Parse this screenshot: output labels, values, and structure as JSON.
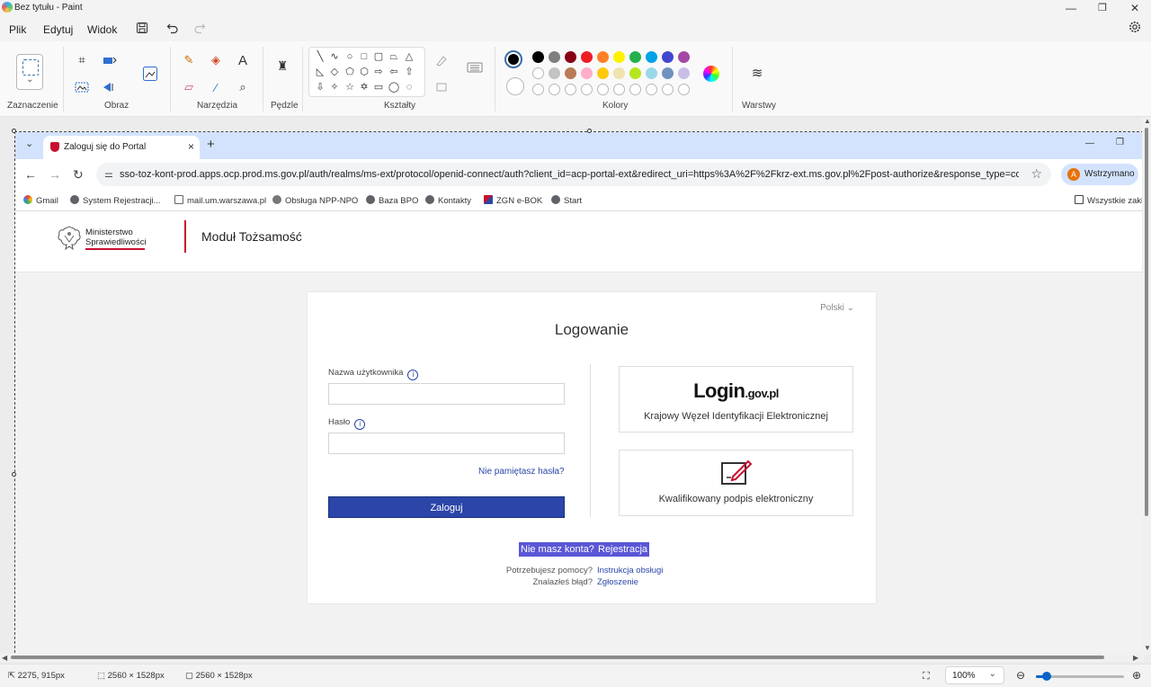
{
  "window": {
    "title": "Bez tytułu - Paint",
    "minimize": "—",
    "maximize": "❐",
    "close": "✕"
  },
  "menu": {
    "items": [
      "Plik",
      "Edytuj",
      "Widok"
    ]
  },
  "ribbon": {
    "groups": {
      "selection": "Zaznaczenie",
      "image": "Obraz",
      "tools": "Narzędzia",
      "brushes": "Pędzle",
      "shapes": "Kształty",
      "colors": "Kolory",
      "layers": "Warstwy"
    },
    "tool_icons": {
      "crop": "⌗",
      "rotate": "⟳",
      "pencil": "✎",
      "fill": "◈",
      "text": "A",
      "eraser": "▱",
      "picker": "⁄",
      "zoom": "⌕",
      "brush": "♜",
      "layers": "≋"
    },
    "shapes": [
      "╲",
      "∿",
      "○",
      "□",
      "▢",
      "⏢",
      "△",
      "◺",
      "◇",
      "⬠",
      "⬡",
      "⇨",
      "⇦",
      "⇧",
      "⇩",
      "✧",
      "☆",
      "✡",
      "▭",
      "◯",
      "◌"
    ],
    "palette_row1": [
      "#000000",
      "#7f7f7f",
      "#880015",
      "#ed1c24",
      "#ff7f27",
      "#fff200",
      "#22b14c",
      "#00a2e8",
      "#3f48cc",
      "#a349a4"
    ],
    "palette_row2": [
      "#ffffff",
      "#c3c3c3",
      "#b97a57",
      "#ffaec9",
      "#ffc90e",
      "#efe4b0",
      "#b5e61d",
      "#99d9ea",
      "#7092be",
      "#c8bfe7"
    ],
    "primary_color": "#000000",
    "secondary_color": "#ffffff"
  },
  "browser": {
    "tab_title": "Zaloguj się do Portal",
    "new_tab": "+",
    "minimize": "—",
    "maximize": "❐",
    "url": "sso-toz-kont-prod.apps.ocp.prod.ms.gov.pl/auth/realms/ms-ext/protocol/openid-connect/auth?client_id=acp-portal-ext&redirect_uri=https%3A%2F%2Fkrz-ext.ms.gov.pl%2Fpost-authorize&response_type=code&s...",
    "profile_initial": "A",
    "profile_label": "Wstrzymano",
    "bookmarks": [
      "Gmail",
      "System Rejestracji...",
      "mail.um.warszawa.pl",
      "Obsługa NPP-NPO",
      "Baza BPO",
      "Kontakty",
      "ZGN e-BOK",
      "Start"
    ],
    "all_bookmarks": "Wszystkie zakł"
  },
  "site": {
    "org_name_line1": "Ministerstwo",
    "org_name_line2": "Sprawiedliwości",
    "header_title": "Moduł Tożsamość",
    "language": "Polski",
    "login_title": "Logowanie",
    "username_label": "Nazwa użytkownika",
    "username_value": "",
    "password_label": "Hasło",
    "password_value": "",
    "info_glyph": "i",
    "forgot_password": "Nie pamiętasz hasła?",
    "login_button": "Zaloguj",
    "login_gov_main": "Login",
    "login_gov_suffix": ".gov.pl",
    "login_gov_caption": "Krajowy Węzeł Identyfikacji Elektronicznej",
    "qes_caption": "Kwalifikowany podpis elektroniczny",
    "no_account": "Nie masz konta?",
    "register": "Rejestracja",
    "help_question": "Potrzebujesz pomocy?",
    "help_link": "Instrukcja obsługi",
    "bug_question": "Znalazłeś błąd?",
    "bug_link": "Zgłoszenie"
  },
  "status": {
    "cursor_pos": "2275, 915px",
    "selection_size": "2560 × 1528px",
    "canvas_size": "2560 × 1528px",
    "zoom_value": "100%",
    "zoom_level": 0.12
  }
}
